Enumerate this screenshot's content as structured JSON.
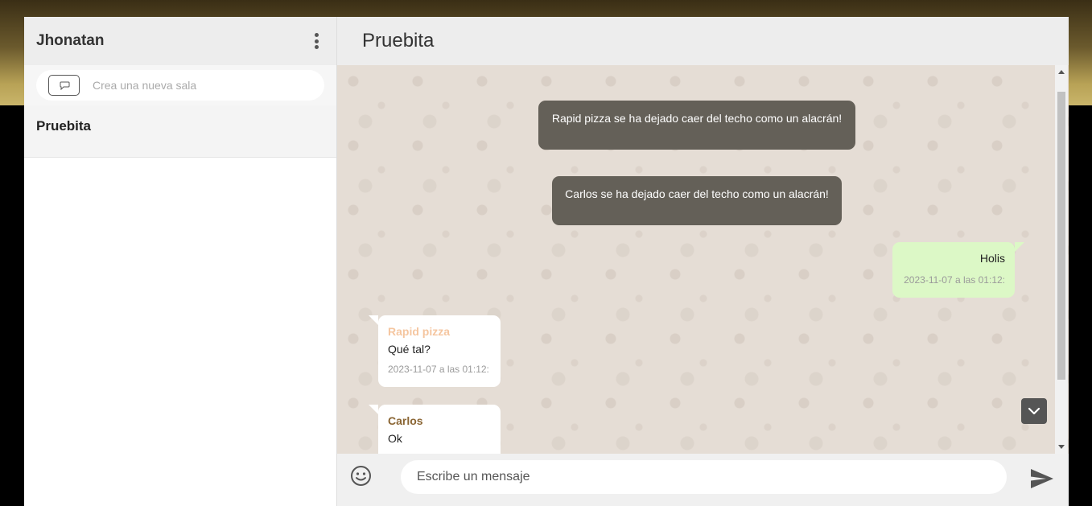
{
  "sidebar": {
    "username": "Jhonatan",
    "menu_icon": "kebab-menu-icon",
    "new_room_icon": "chat-bubble-icon",
    "search_placeholder": "Crea una nueva sala",
    "rooms": [
      {
        "name": "Pruebita"
      }
    ]
  },
  "chat": {
    "title": "Pruebita",
    "system_messages": [
      {
        "text": "Rapid pizza se ha dejado caer del techo como un alacrán!"
      },
      {
        "text": "Carlos se ha dejado caer del techo como un alacrán!"
      }
    ],
    "outgoing": [
      {
        "text": "Holis",
        "time": "2023-11-07 a las 01:12:"
      }
    ],
    "incoming": [
      {
        "sender": "Rapid pizza",
        "sender_color": "#f5c6a0",
        "text": "Qué tal?",
        "time": "2023-11-07 a las 01:12:"
      },
      {
        "sender": "Carlos",
        "sender_color": "#8a6533",
        "text": "Ok",
        "time": ""
      }
    ],
    "scroll_down_icon": "chevron-down-icon"
  },
  "composer": {
    "emoji_icon": "smiley-icon",
    "placeholder": "Escribe un mensaje",
    "send_icon": "send-arrow-icon"
  }
}
